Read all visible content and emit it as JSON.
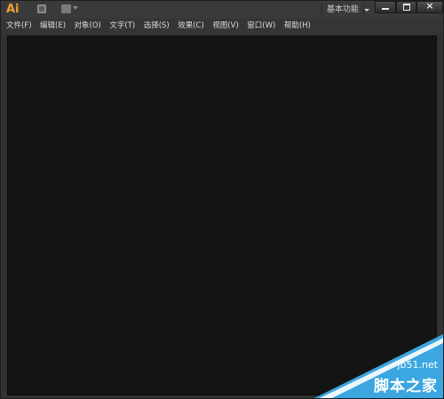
{
  "titlebar": {
    "logo": "Ai",
    "workspace": "基本功能"
  },
  "menu": [
    "文件(F)",
    "编辑(E)",
    "对象(O)",
    "文字(T)",
    "选择(S)",
    "效果(C)",
    "视图(V)",
    "窗口(W)",
    "帮助(H)"
  ],
  "window_buttons": {
    "close_glyph": "×"
  },
  "watermark": {
    "line1": "jb51.net",
    "line2": "脚本之家"
  },
  "colors": {
    "logo": "#f0a030",
    "canvas": "#141414",
    "watermark": "#3ba6e0"
  },
  "icons": [
    "bridge-icon",
    "arrange-documents-icon",
    "minimize-icon",
    "maximize-icon",
    "close-icon"
  ]
}
